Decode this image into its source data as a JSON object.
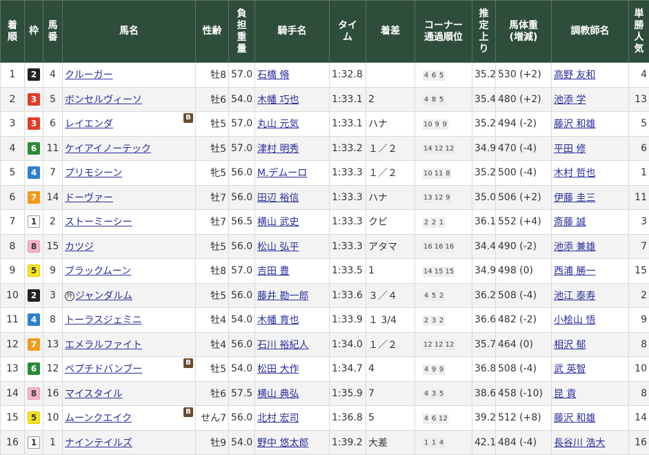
{
  "headers": {
    "rank": "着順",
    "waku": "枠",
    "umaban": "馬番",
    "horse": "馬名",
    "sex_age": "性齢",
    "weight_carried": "負担重量",
    "jockey": "騎手名",
    "time": "タイム",
    "margin": "着差",
    "corner_1": "コーナー",
    "corner_2": "通過順位",
    "last3f": "推定上り",
    "body_weight_1": "馬体重",
    "body_weight_2": "(増減)",
    "trainer": "調教師名",
    "popularity": "単勝人気"
  },
  "rows": [
    {
      "rank": "1",
      "waku": "2",
      "waku_color": "#222222",
      "umaban": "4",
      "horse": "クルーガー",
      "blinker": "",
      "mark": "",
      "sex_age": "牡8",
      "wt": "57.0",
      "jockey": "石橋 脩",
      "time": "1:32.8",
      "margin": "",
      "corner": [
        "4",
        "6",
        "5"
      ],
      "last3f": "35.2",
      "bw": "530 (+2)",
      "trainer": "高野 友和",
      "pop": "4"
    },
    {
      "rank": "2",
      "waku": "3",
      "waku_color": "#e33b2b",
      "umaban": "5",
      "horse": "ボンセルヴィーソ",
      "blinker": "",
      "mark": "",
      "sex_age": "牡6",
      "wt": "54.0",
      "jockey": "木幡 巧也",
      "time": "1:33.1",
      "margin": "2",
      "corner": [
        "4",
        "8",
        "5"
      ],
      "last3f": "35.4",
      "bw": "480 (+2)",
      "trainer": "池添 学",
      "pop": "13"
    },
    {
      "rank": "3",
      "waku": "3",
      "waku_color": "#e33b2b",
      "umaban": "6",
      "horse": "レイエンダ",
      "blinker": "B",
      "mark": "",
      "sex_age": "牡5",
      "wt": "57.0",
      "jockey": "丸山 元気",
      "time": "1:33.1",
      "margin": "ハナ",
      "corner": [
        "10",
        "9",
        "9"
      ],
      "last3f": "35.2",
      "bw": "494 (-2)",
      "trainer": "藤沢 和雄",
      "pop": "5"
    },
    {
      "rank": "4",
      "waku": "6",
      "waku_color": "#2a8a3a",
      "umaban": "11",
      "horse": "ケイアイノーテック",
      "blinker": "",
      "mark": "",
      "sex_age": "牡5",
      "wt": "57.0",
      "jockey": "津村 明秀",
      "time": "1:33.2",
      "margin": "１／２",
      "corner": [
        "14",
        "12",
        "12"
      ],
      "last3f": "34.9",
      "bw": "470 (-4)",
      "trainer": "平田 修",
      "pop": "6"
    },
    {
      "rank": "5",
      "waku": "4",
      "waku_color": "#2c7fd1",
      "umaban": "7",
      "horse": "プリモシーン",
      "blinker": "",
      "mark": "",
      "sex_age": "牝5",
      "wt": "56.0",
      "jockey": "M.デムーロ",
      "time": "1:33.3",
      "margin": "１／２",
      "corner": [
        "10",
        "11",
        "8"
      ],
      "last3f": "35.2",
      "bw": "500 (-4)",
      "trainer": "木村 哲也",
      "pop": "1"
    },
    {
      "rank": "6",
      "waku": "7",
      "waku_color": "#f39a1c",
      "umaban": "14",
      "horse": "ドーヴァー",
      "blinker": "",
      "mark": "",
      "sex_age": "牡7",
      "wt": "56.0",
      "jockey": "田辺 裕信",
      "time": "1:33.3",
      "margin": "ハナ",
      "corner": [
        "13",
        "12",
        "9"
      ],
      "last3f": "35.0",
      "bw": "506 (+2)",
      "trainer": "伊藤 圭三",
      "pop": "11"
    },
    {
      "rank": "7",
      "waku": "1",
      "waku_color": "#ffffff",
      "umaban": "2",
      "horse": "ストーミーシー",
      "blinker": "",
      "mark": "",
      "sex_age": "牡7",
      "wt": "56.5",
      "jockey": "横山 武史",
      "time": "1:33.3",
      "margin": "クビ",
      "corner": [
        "2",
        "2",
        "1"
      ],
      "last3f": "36.1",
      "bw": "552 (+4)",
      "trainer": "斎藤 誠",
      "pop": "3"
    },
    {
      "rank": "8",
      "waku": "8",
      "waku_color": "#f5b2c7",
      "umaban": "15",
      "horse": "カツジ",
      "blinker": "",
      "mark": "",
      "sex_age": "牡5",
      "wt": "56.0",
      "jockey": "松山 弘平",
      "time": "1:33.3",
      "margin": "アタマ",
      "corner": [
        "16",
        "16",
        "16"
      ],
      "last3f": "34.4",
      "bw": "490 (-2)",
      "trainer": "池添 兼雄",
      "pop": "7"
    },
    {
      "rank": "9",
      "waku": "5",
      "waku_color": "#f6e21d",
      "umaban": "9",
      "horse": "ブラックムーン",
      "blinker": "",
      "mark": "",
      "sex_age": "牡8",
      "wt": "57.0",
      "jockey": "吉田 豊",
      "time": "1:33.5",
      "margin": "1",
      "corner": [
        "14",
        "15",
        "15"
      ],
      "last3f": "34.9",
      "bw": "498 (0)",
      "trainer": "西浦 勝一",
      "pop": "15"
    },
    {
      "rank": "10",
      "waku": "2",
      "waku_color": "#222222",
      "umaban": "3",
      "horse": "ジャンダルム",
      "blinker": "",
      "mark": "外",
      "sex_age": "牡5",
      "wt": "56.0",
      "jockey": "藤井 勘一郎",
      "time": "1:33.6",
      "margin": "３／４",
      "corner": [
        "4",
        "5",
        "2"
      ],
      "last3f": "36.2",
      "bw": "508 (-4)",
      "trainer": "池江 泰寿",
      "pop": "2"
    },
    {
      "rank": "11",
      "waku": "4",
      "waku_color": "#2c7fd1",
      "umaban": "8",
      "horse": "トーラスジェミニ",
      "blinker": "",
      "mark": "",
      "sex_age": "牡4",
      "wt": "54.0",
      "jockey": "木幡 育也",
      "time": "1:33.9",
      "margin": "１ 3/4",
      "corner": [
        "2",
        "3",
        "2"
      ],
      "last3f": "36.6",
      "bw": "482 (-2)",
      "trainer": "小桧山 悟",
      "pop": "9"
    },
    {
      "rank": "12",
      "waku": "7",
      "waku_color": "#f39a1c",
      "umaban": "13",
      "horse": "エメラルファイト",
      "blinker": "",
      "mark": "",
      "sex_age": "牡4",
      "wt": "56.0",
      "jockey": "石川 裕紀人",
      "time": "1:34.0",
      "margin": "１／２",
      "corner": [
        "12",
        "12",
        "12"
      ],
      "last3f": "35.7",
      "bw": "464 (0)",
      "trainer": "相沢 郁",
      "pop": "8"
    },
    {
      "rank": "13",
      "waku": "6",
      "waku_color": "#2a8a3a",
      "umaban": "12",
      "horse": "ペプチドバンブー",
      "blinker": "B",
      "mark": "",
      "sex_age": "牡5",
      "wt": "54.0",
      "jockey": "松田 大作",
      "time": "1:34.7",
      "margin": "4",
      "corner": [
        "4",
        "9",
        "9"
      ],
      "last3f": "36.8",
      "bw": "508 (-4)",
      "trainer": "武 英智",
      "pop": "10"
    },
    {
      "rank": "14",
      "waku": "8",
      "waku_color": "#f5b2c7",
      "umaban": "16",
      "horse": "マイスタイル",
      "blinker": "",
      "mark": "",
      "sex_age": "牡6",
      "wt": "57.5",
      "jockey": "横山 典弘",
      "time": "1:35.9",
      "margin": "7",
      "corner": [
        "4",
        "3",
        "5"
      ],
      "last3f": "38.6",
      "bw": "458 (-10)",
      "trainer": "昆 貢",
      "pop": "8"
    },
    {
      "rank": "15",
      "waku": "5",
      "waku_color": "#f6e21d",
      "umaban": "10",
      "horse": "ムーンクエイク",
      "blinker": "B",
      "mark": "",
      "sex_age": "せん7",
      "wt": "56.0",
      "jockey": "北村 宏司",
      "time": "1:36.8",
      "margin": "5",
      "corner": [
        "4",
        "6",
        "12"
      ],
      "last3f": "39.2",
      "bw": "512 (+8)",
      "trainer": "藤沢 和雄",
      "pop": "14"
    },
    {
      "rank": "16",
      "waku": "1",
      "waku_color": "#ffffff",
      "umaban": "1",
      "horse": "ナインテイルズ",
      "blinker": "",
      "mark": "",
      "sex_age": "牡9",
      "wt": "54.0",
      "jockey": "野中 悠太郎",
      "time": "1:39.2",
      "margin": "大差",
      "corner": [
        "1",
        "1",
        "4"
      ],
      "last3f": "42.1",
      "bw": "484 (-4)",
      "trainer": "長谷川 浩大",
      "pop": "16"
    }
  ]
}
